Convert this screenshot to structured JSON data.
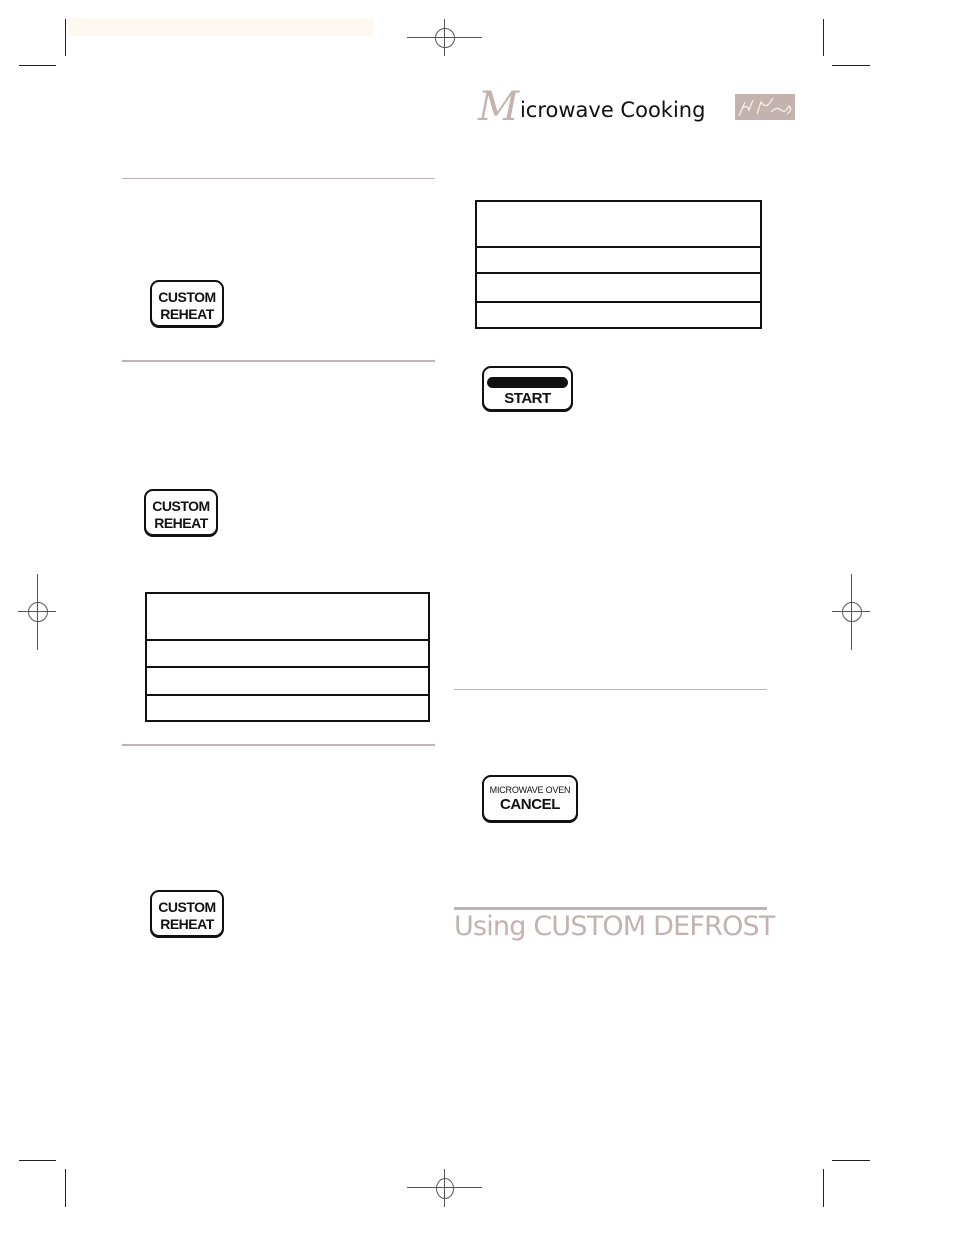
{
  "header": {
    "title_initial": "M",
    "title_rest": "icrowave Cooking",
    "signature_icon": "signature-decoration"
  },
  "colors": {
    "accent": "#c4b2ae",
    "text": "#111111",
    "top_band": "#fdf8f2"
  },
  "left_column": {
    "keys": [
      {
        "line1": "CUSTOM",
        "line2": "REHEAT"
      },
      {
        "line1": "CUSTOM",
        "line2": "REHEAT"
      },
      {
        "line1": "CUSTOM",
        "line2": "REHEAT"
      }
    ],
    "table": {
      "rows": [
        "",
        "",
        "",
        ""
      ]
    }
  },
  "right_column": {
    "table": {
      "rows": [
        "",
        "",
        "",
        ""
      ]
    },
    "start_key": {
      "label": "START"
    },
    "cancel_key": {
      "line1": "MICROWAVE OVEN",
      "line2": "CANCEL"
    },
    "section_title": "Using CUSTOM DEFROST"
  }
}
